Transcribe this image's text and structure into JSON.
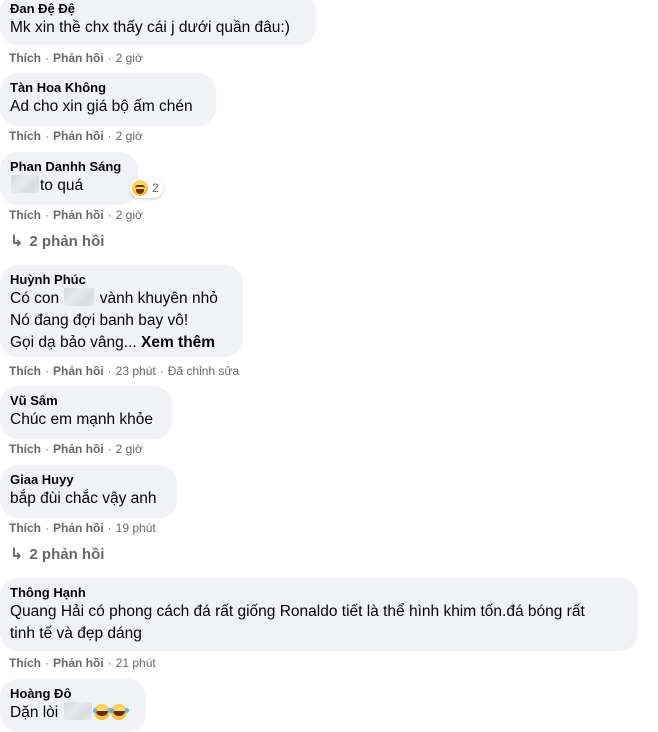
{
  "comments": [
    {
      "author": "Đan Đệ Đệ",
      "text": "Mk xin thề chx thấy cái j dưới quần đâu:)",
      "time": "2 giờ"
    },
    {
      "author": "Tàn Hoa Không",
      "text": "Ad cho xin giá bộ ấm chén",
      "time": "2 giờ"
    },
    {
      "author": "Phan Danhh Sáng",
      "text": "to quá",
      "time": "2 giờ",
      "reaction_count": "2",
      "replies_label": "2 phản hồi"
    },
    {
      "author": "Huỳnh Phúc",
      "line1_a": "Có con",
      "line1_b": "vành khuyên nhỏ",
      "line2": "Nó đang đợi banh bay vô!",
      "line3": "Gọi dạ bảo vâng...",
      "see_more": "Xem thêm",
      "time": "23 phút",
      "edited": "Đã chỉnh sửa"
    },
    {
      "author": "Vũ Sâm",
      "text": "Chúc em mạnh khỏe",
      "time": "2 giờ"
    },
    {
      "author": "Giaa Huyy",
      "text": "bắp đùi chắc vậy anh",
      "time": "19 phút",
      "replies_label": "2 phản hồi"
    },
    {
      "author": "Thông Hạnh",
      "line1": "Quang Hải có phong cách đá rất giống Ronaldo tiết là thể hình khim tốn.đá bóng rất",
      "line2": "tinh tế và đẹp dáng",
      "time": "21 phút"
    },
    {
      "author": "Hoàng Đô",
      "text": "Dặn lòi"
    }
  ],
  "actions": {
    "like": "Thích",
    "reply": "Phản hồi",
    "dot": "·"
  },
  "icons": {
    "reply_arrow": "reply-arrow-icon",
    "haha": "haha-reaction-icon",
    "laugh_emoji": "laugh-tears-emoji-icon"
  },
  "colors": {
    "bubble": "#f0f2f5",
    "meta": "#65676b",
    "text": "#050505"
  }
}
